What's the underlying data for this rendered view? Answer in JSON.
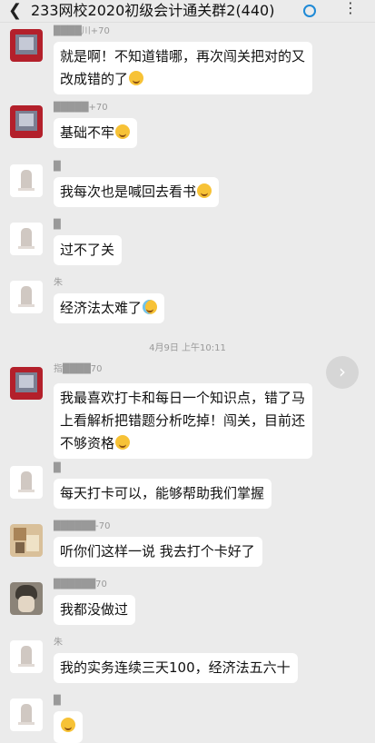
{
  "header": {
    "back_icon": "chevron-left-icon",
    "title": "233网校2020初级会计通关群2(440)",
    "status_icon": "loading-circle-icon",
    "menu_icon": "more-icon",
    "menu_glyph": "⋮"
  },
  "divider_time": "4月9日 上午10:11",
  "forward_glyph": "›",
  "messages": [
    {
      "name": "████川+70",
      "lines": [
        "就是啊！不知道错哪，再次闯关把对的又",
        "改成错的了"
      ],
      "emoji": "laugh-cry-emoji"
    },
    {
      "name": "█████+70",
      "lines": [
        "基础不牢"
      ],
      "emoji": "laugh-cry-emoji"
    },
    {
      "name": "█",
      "lines": [
        "我每次也是喊回去看书"
      ],
      "emoji": "laugh-cry-emoji"
    },
    {
      "name": "█",
      "lines": [
        "过不了关"
      ]
    },
    {
      "name": "朱",
      "lines": [
        "经济法太难了"
      ],
      "emoji": "crying-emoji"
    },
    {
      "name": "指████70",
      "lines": [
        "我最喜欢打卡和每日一个知识点，错了马",
        "上看解析把错题分析吃掉！闯关，目前还",
        "不够资格"
      ],
      "emoji": "laugh-cry-emoji"
    },
    {
      "name": "█",
      "lines": [
        "每天打卡可以，能够帮助我们掌握"
      ]
    },
    {
      "name": "██████-70",
      "lines": [
        "听你们这样一说 我去打个卡好了"
      ]
    },
    {
      "name": "██████70",
      "lines": [
        "我都没做过"
      ]
    },
    {
      "name": "朱",
      "lines": [
        "我的实务连续三天100，经济法五六十"
      ]
    },
    {
      "name": "█",
      "lines": [],
      "emoji": "laugh-cry-emoji"
    }
  ]
}
